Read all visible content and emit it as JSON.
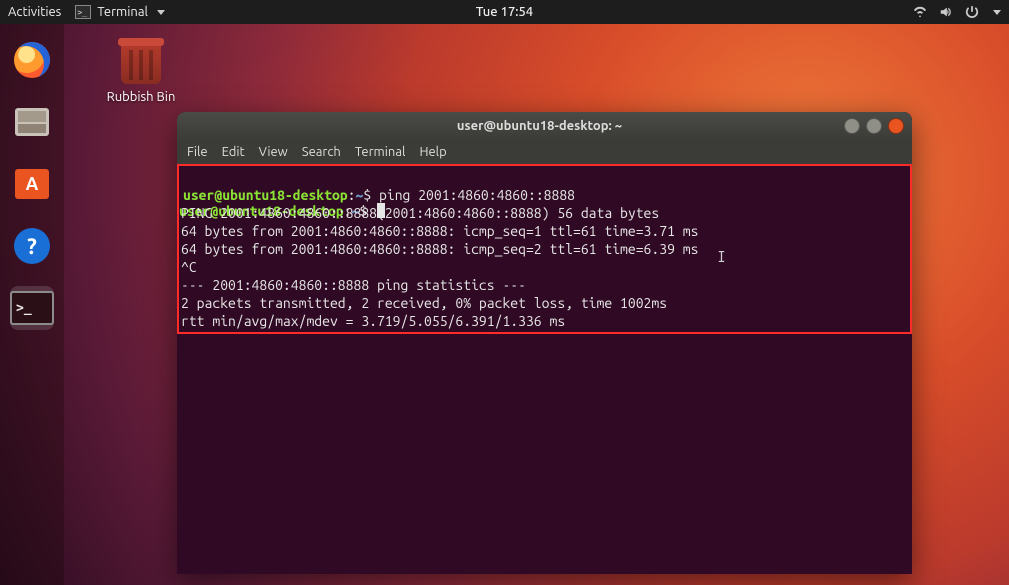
{
  "topbar": {
    "activities": "Activities",
    "app_label": "Terminal",
    "clock": "Tue 17:54"
  },
  "desktop": {
    "trash_label": "Rubbish Bin"
  },
  "dock": {
    "items": [
      "firefox",
      "files",
      "software",
      "help",
      "terminal"
    ]
  },
  "terminal": {
    "title": "user@ubuntu18-desktop: ~",
    "menu": {
      "file": "File",
      "edit": "Edit",
      "view": "View",
      "search": "Search",
      "terminal": "Terminal",
      "help": "Help"
    },
    "prompt": {
      "user_host": "user@ubuntu18-desktop",
      "sep": ":",
      "path": "~",
      "sigil": "$"
    },
    "command": "ping 2001:4860:4860::8888",
    "output": [
      "PING 2001:4860:4860::8888(2001:4860:4860::8888) 56 data bytes",
      "64 bytes from 2001:4860:4860::8888: icmp_seq=1 ttl=61 time=3.71 ms",
      "64 bytes from 2001:4860:4860::8888: icmp_seq=2 ttl=61 time=6.39 ms",
      "^C",
      "--- 2001:4860:4860::8888 ping statistics ---",
      "2 packets transmitted, 2 received, 0% packet loss, time 1002ms",
      "rtt min/avg/max/mdev = 3.719/5.055/6.391/1.336 ms"
    ]
  }
}
